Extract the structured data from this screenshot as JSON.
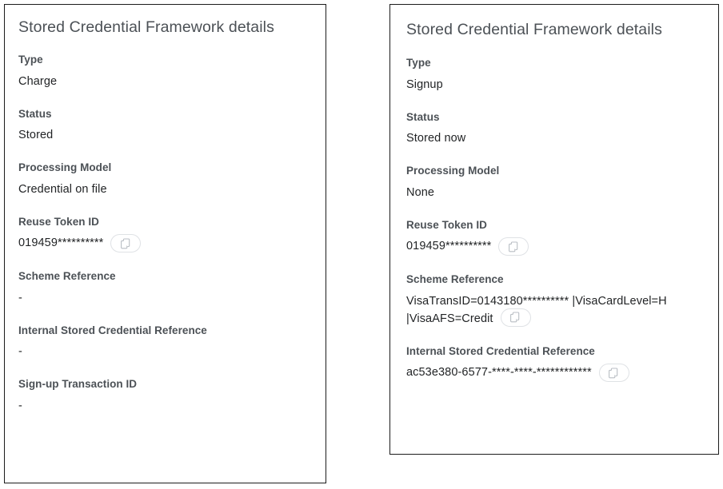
{
  "colors": {
    "label": "#4c5156",
    "value": "#222426",
    "border": "#1c1c1c",
    "button_border": "#dfe2e5",
    "background": "#ffffff"
  },
  "icons": {
    "copy": "copy-icon"
  },
  "panels": [
    {
      "id": "left",
      "title": "Stored Credential Framework details",
      "fields": [
        {
          "label": "Type",
          "value": "Charge",
          "copyable": false
        },
        {
          "label": "Status",
          "value": "Stored",
          "copyable": false
        },
        {
          "label": "Processing Model",
          "value": "Credential on file",
          "copyable": false
        },
        {
          "label": "Reuse Token ID",
          "value": "019459**********",
          "copyable": true
        },
        {
          "label": "Scheme Reference",
          "value": "-",
          "copyable": false
        },
        {
          "label": "Internal Stored Credential Reference",
          "value": "-",
          "copyable": false
        },
        {
          "label": "Sign-up Transaction ID",
          "value": "-",
          "copyable": false
        }
      ]
    },
    {
      "id": "right",
      "title": "Stored Credential Framework details",
      "fields": [
        {
          "label": "Type",
          "value": "Signup",
          "copyable": false
        },
        {
          "label": "Status",
          "value": "Stored now",
          "copyable": false
        },
        {
          "label": "Processing Model",
          "value": "None",
          "copyable": false
        },
        {
          "label": "Reuse Token ID",
          "value": "019459**********",
          "copyable": true
        },
        {
          "label": "Scheme Reference",
          "value": "VisaTransID=0143180********** |VisaCardLevel=H |VisaAFS=Credit",
          "copyable": true
        },
        {
          "label": "Internal Stored Credential Reference",
          "value": "ac53e380-6577-****-****-************",
          "copyable": true
        }
      ]
    }
  ]
}
